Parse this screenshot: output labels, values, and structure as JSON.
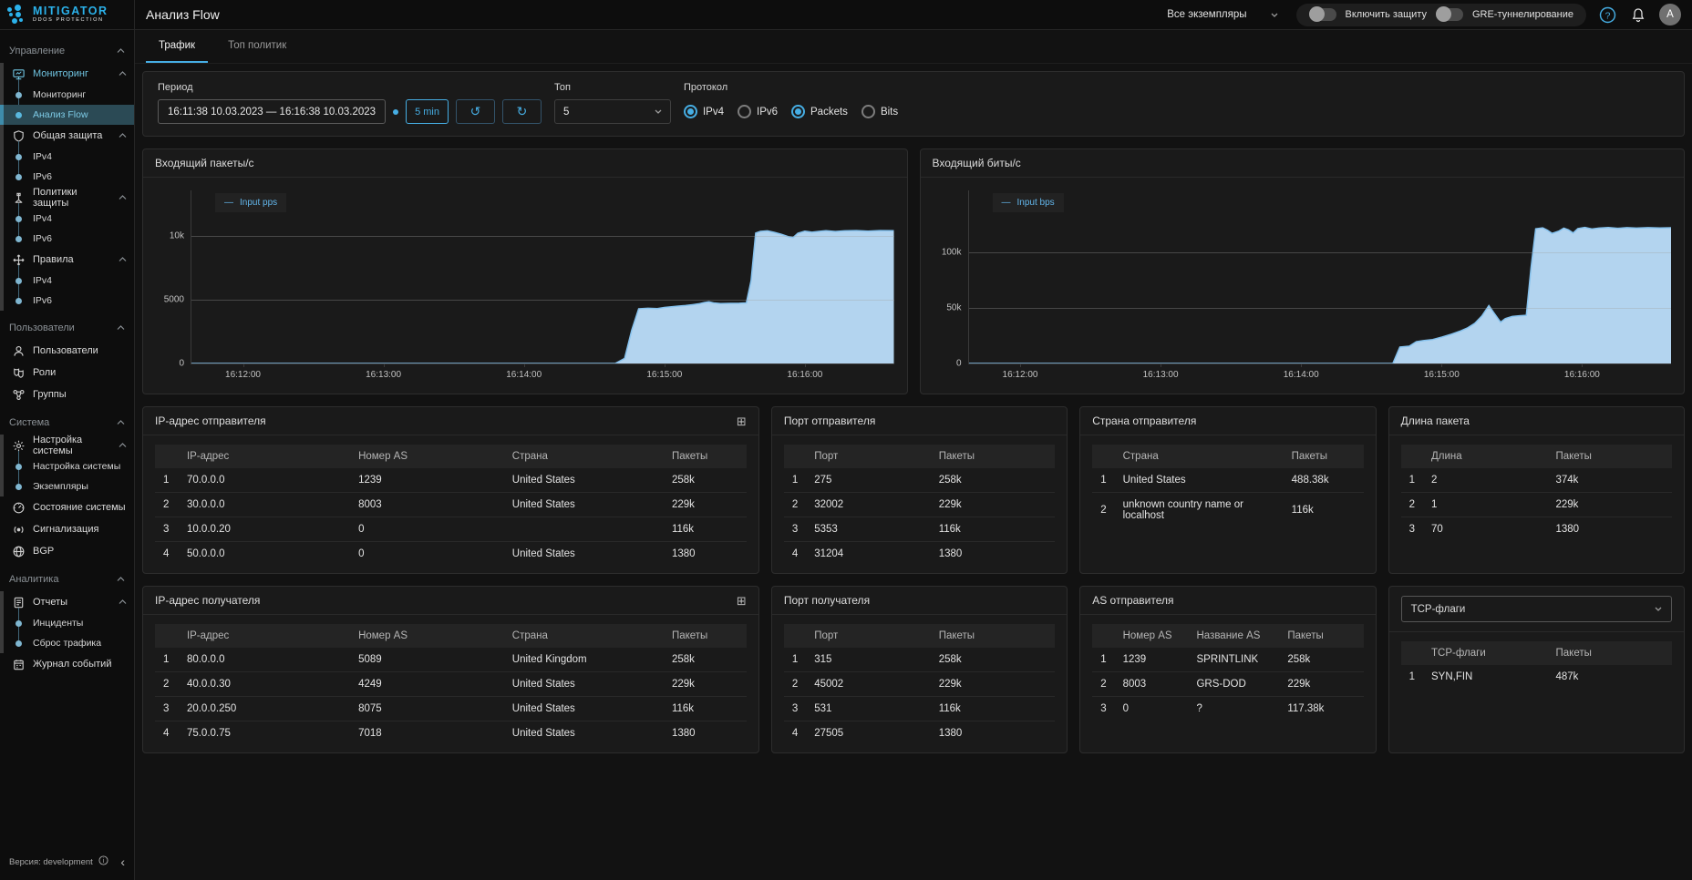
{
  "logo": {
    "name": "MITIGATOR",
    "subtitle": "DDOS PROTECTION"
  },
  "header": {
    "title": "Анализ Flow",
    "instances_select": "Все экземпляры",
    "toggle_protect": "Включить защиту",
    "toggle_gre": "GRE-туннелирование",
    "avatar": "A"
  },
  "tabs": [
    {
      "label": "Трафик",
      "active": true
    },
    {
      "label": "Топ политик",
      "active": false
    }
  ],
  "filters": {
    "period_label": "Период",
    "period_value": "16:11:38 10.03.2023 — 16:16:38 10.03.2023",
    "quick_range": "5 min",
    "undo_icon": "↺",
    "redo_icon": "↻",
    "top_label": "Топ",
    "top_value": "5",
    "protocol_label": "Протокол",
    "radios": [
      {
        "name": "ipv4",
        "label": "IPv4",
        "checked": true
      },
      {
        "name": "ipv6",
        "label": "IPv6",
        "checked": false
      },
      {
        "name": "packets",
        "label": "Packets",
        "checked": true
      },
      {
        "name": "bits",
        "label": "Bits",
        "checked": false
      }
    ]
  },
  "sidebar": {
    "sections": [
      {
        "name": "management",
        "label": "Управление",
        "items": [
          {
            "name": "monitoring-group",
            "label": "Мониторинг",
            "icon": "monitor-icon",
            "expanded": true,
            "highlight": true,
            "children": [
              {
                "name": "monitoring",
                "label": "Мониторинг"
              },
              {
                "name": "flow-analysis",
                "label": "Анализ Flow",
                "active": true
              }
            ]
          },
          {
            "name": "general-protection",
            "label": "Общая защита",
            "icon": "shield-icon",
            "expanded": true,
            "children": [
              {
                "name": "general-protection-ipv4",
                "label": "IPv4"
              },
              {
                "name": "general-protection-ipv6",
                "label": "IPv6"
              }
            ]
          },
          {
            "name": "protection-policies",
            "label": "Политики защиты",
            "icon": "policy-icon",
            "expanded": true,
            "children": [
              {
                "name": "policies-ipv4",
                "label": "IPv4"
              },
              {
                "name": "policies-ipv6",
                "label": "IPv6"
              }
            ]
          },
          {
            "name": "rules",
            "label": "Правила",
            "icon": "rules-icon",
            "expanded": true,
            "children": [
              {
                "name": "rules-ipv4",
                "label": "IPv4"
              },
              {
                "name": "rules-ipv6",
                "label": "IPv6"
              }
            ]
          }
        ]
      },
      {
        "name": "users",
        "label": "Пользователи",
        "items": [
          {
            "name": "users",
            "label": "Пользователи",
            "icon": "user-icon"
          },
          {
            "name": "roles",
            "label": "Роли",
            "icon": "roles-icon"
          },
          {
            "name": "groups",
            "label": "Группы",
            "icon": "groups-icon"
          }
        ]
      },
      {
        "name": "system",
        "label": "Система",
        "items": [
          {
            "name": "system-settings-group",
            "label": "Настройка системы",
            "icon": "gear-icon",
            "expanded": true,
            "children": [
              {
                "name": "system-settings",
                "label": "Настройка системы"
              },
              {
                "name": "instances",
                "label": "Экземпляры"
              }
            ]
          },
          {
            "name": "system-status",
            "label": "Состояние системы",
            "icon": "gauge-icon"
          },
          {
            "name": "alarms",
            "label": "Сигнализация",
            "icon": "signal-icon"
          },
          {
            "name": "bgp",
            "label": "BGP",
            "icon": "globe-icon"
          }
        ]
      },
      {
        "name": "analytics",
        "label": "Аналитика",
        "items": [
          {
            "name": "reports-group",
            "label": "Отчеты",
            "icon": "report-icon",
            "expanded": true,
            "children": [
              {
                "name": "incidents",
                "label": "Инциденты"
              },
              {
                "name": "traffic-dump",
                "label": "Сброс трафика"
              }
            ]
          },
          {
            "name": "event-log",
            "label": "Журнал событий",
            "icon": "journal-icon"
          }
        ]
      }
    ],
    "footer": {
      "version": "Версия: development"
    }
  },
  "chart_data": [
    {
      "type": "area",
      "title": "Входящий пакеты/с",
      "legend": "Input pps",
      "ylim": [
        0,
        13600
      ],
      "gridlines": [
        {
          "value": 5000,
          "label": "5000"
        },
        {
          "value": 10000,
          "label": "10k"
        }
      ],
      "zero_label": "0",
      "x_range_seconds": [
        0,
        300
      ],
      "x_start": "16:11:38",
      "x_end": "16:16:38",
      "x_ticks": [
        {
          "t": 22,
          "label": "16:12:00"
        },
        {
          "t": 82,
          "label": "16:13:00"
        },
        {
          "t": 142,
          "label": "16:14:00"
        },
        {
          "t": 202,
          "label": "16:15:00"
        },
        {
          "t": 262,
          "label": "16:16:00"
        }
      ],
      "points": [
        [
          0,
          0
        ],
        [
          181,
          0
        ],
        [
          185,
          400
        ],
        [
          188,
          2600
        ],
        [
          191,
          4300
        ],
        [
          195,
          4340
        ],
        [
          199,
          4310
        ],
        [
          202,
          4400
        ],
        [
          205,
          4460
        ],
        [
          208,
          4510
        ],
        [
          211,
          4550
        ],
        [
          214,
          4620
        ],
        [
          217,
          4700
        ],
        [
          219,
          4790
        ],
        [
          221,
          4850
        ],
        [
          223,
          4760
        ],
        [
          226,
          4710
        ],
        [
          230,
          4720
        ],
        [
          234,
          4730
        ],
        [
          237,
          4760
        ],
        [
          239,
          6500
        ],
        [
          241,
          10250
        ],
        [
          243,
          10380
        ],
        [
          246,
          10420
        ],
        [
          249,
          10300
        ],
        [
          252,
          10150
        ],
        [
          255,
          9960
        ],
        [
          257,
          9900
        ],
        [
          259,
          10230
        ],
        [
          262,
          10400
        ],
        [
          265,
          10320
        ],
        [
          268,
          10380
        ],
        [
          271,
          10430
        ],
        [
          275,
          10370
        ],
        [
          279,
          10420
        ],
        [
          284,
          10440
        ],
        [
          289,
          10400
        ],
        [
          294,
          10440
        ],
        [
          300,
          10430
        ]
      ]
    },
    {
      "type": "area",
      "title": "Входящий биты/с",
      "legend": "Input bps",
      "ylim": [
        0,
        156000
      ],
      "gridlines": [
        {
          "value": 50000,
          "label": "50k"
        },
        {
          "value": 100000,
          "label": "100k"
        }
      ],
      "zero_label": "0",
      "x_range_seconds": [
        0,
        300
      ],
      "x_start": "16:11:38",
      "x_end": "16:16:38",
      "x_ticks": [
        {
          "t": 22,
          "label": "16:12:00"
        },
        {
          "t": 82,
          "label": "16:13:00"
        },
        {
          "t": 142,
          "label": "16:14:00"
        },
        {
          "t": 202,
          "label": "16:15:00"
        },
        {
          "t": 262,
          "label": "16:16:00"
        }
      ],
      "points": [
        [
          0,
          0
        ],
        [
          181,
          0
        ],
        [
          184,
          14800
        ],
        [
          188,
          15600
        ],
        [
          191,
          19600
        ],
        [
          194,
          20600
        ],
        [
          198,
          21600
        ],
        [
          202,
          23800
        ],
        [
          206,
          26400
        ],
        [
          210,
          29400
        ],
        [
          213,
          32200
        ],
        [
          216,
          36200
        ],
        [
          219,
          42800
        ],
        [
          222,
          52200
        ],
        [
          224,
          46000
        ],
        [
          227,
          37200
        ],
        [
          229,
          40400
        ],
        [
          232,
          42400
        ],
        [
          235,
          43000
        ],
        [
          238,
          43400
        ],
        [
          240,
          86000
        ],
        [
          242,
          121400
        ],
        [
          245,
          122200
        ],
        [
          247,
          120200
        ],
        [
          249,
          117200
        ],
        [
          252,
          119400
        ],
        [
          254,
          122000
        ],
        [
          256,
          120400
        ],
        [
          258,
          117600
        ],
        [
          260,
          121600
        ],
        [
          263,
          122600
        ],
        [
          266,
          121200
        ],
        [
          269,
          122000
        ],
        [
          273,
          122500
        ],
        [
          277,
          121800
        ],
        [
          281,
          122400
        ],
        [
          285,
          122000
        ],
        [
          290,
          122400
        ],
        [
          295,
          122100
        ],
        [
          300,
          122300
        ]
      ]
    }
  ],
  "tables": {
    "ip_src": {
      "title": "IP-адрес отправителя",
      "expandable": true,
      "columns": [
        "IP-адрес",
        "Номер AS",
        "Страна",
        "Пакеты"
      ],
      "rows": [
        [
          "70.0.0.0",
          "1239",
          "United States",
          "258k"
        ],
        [
          "30.0.0.0",
          "8003",
          "United States",
          "229k"
        ],
        [
          "10.0.0.20",
          "0",
          "",
          "116k"
        ],
        [
          "50.0.0.0",
          "0",
          "United States",
          "1380"
        ]
      ]
    },
    "port_src": {
      "title": "Порт отправителя",
      "columns": [
        "Порт",
        "Пакеты"
      ],
      "rows": [
        [
          "275",
          "258k"
        ],
        [
          "32002",
          "229k"
        ],
        [
          "5353",
          "116k"
        ],
        [
          "31204",
          "1380"
        ]
      ]
    },
    "country_src": {
      "title": "Страна отправителя",
      "columns": [
        "Страна",
        "Пакеты"
      ],
      "rows": [
        [
          "United States",
          "488.38k"
        ],
        [
          "unknown country name or localhost",
          "116k"
        ]
      ]
    },
    "pkt_len": {
      "title": "Длина пакета",
      "columns": [
        "Длина",
        "Пакеты"
      ],
      "rows": [
        [
          "2",
          "374k"
        ],
        [
          "1",
          "229k"
        ],
        [
          "70",
          "1380"
        ]
      ]
    },
    "ip_dst": {
      "title": "IP-адрес получателя",
      "expandable": true,
      "columns": [
        "IP-адрес",
        "Номер AS",
        "Страна",
        "Пакеты"
      ],
      "rows": [
        [
          "80.0.0.0",
          "5089",
          "United Kingdom",
          "258k"
        ],
        [
          "40.0.0.30",
          "4249",
          "United States",
          "229k"
        ],
        [
          "20.0.0.250",
          "8075",
          "United States",
          "116k"
        ],
        [
          "75.0.0.75",
          "7018",
          "United States",
          "1380"
        ]
      ]
    },
    "port_dst": {
      "title": "Порт получателя",
      "columns": [
        "Порт",
        "Пакеты"
      ],
      "rows": [
        [
          "315",
          "258k"
        ],
        [
          "45002",
          "229k"
        ],
        [
          "531",
          "116k"
        ],
        [
          "27505",
          "1380"
        ]
      ]
    },
    "as_src": {
      "title": "AS отправителя",
      "columns": [
        "Номер AS",
        "Название AS",
        "Пакеты"
      ],
      "rows": [
        [
          "1239",
          "SPRINTLINK",
          "258k"
        ],
        [
          "8003",
          "GRS-DOD",
          "229k"
        ],
        [
          "0",
          "?",
          "117.38k"
        ]
      ]
    },
    "tcp_flags": {
      "select_label": "TCP-флаги",
      "columns": [
        "TCP-флаги",
        "Пакеты"
      ],
      "rows": [
        [
          "SYN,FIN",
          "487k"
        ]
      ]
    }
  },
  "colors": {
    "accent": "#46aee4",
    "area_fill": "#b9dcf8",
    "area_stroke": "#86c2ee",
    "active_item_bg": "#2b4a55"
  }
}
